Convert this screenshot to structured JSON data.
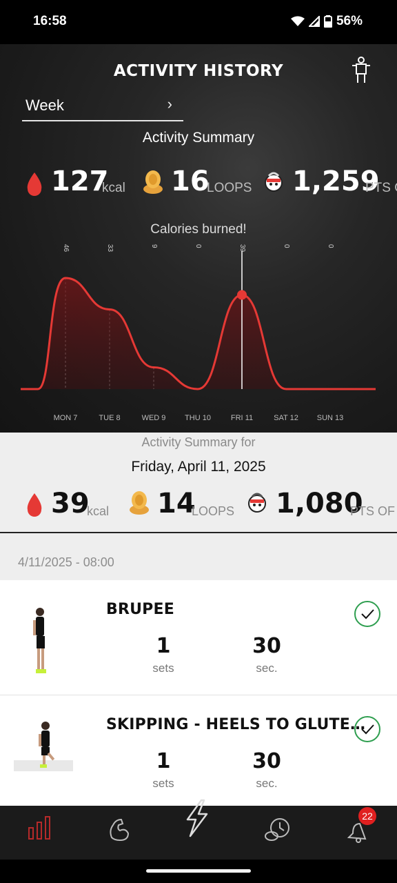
{
  "status_bar": {
    "time": "16:58",
    "battery": "56%"
  },
  "header": {
    "title": "ACTIVITY HISTORY",
    "icons": [
      "person-icon"
    ]
  },
  "period": {
    "label": "Week"
  },
  "summary": {
    "title": "Activity Summary",
    "kcal": "127",
    "kcal_unit": "kcal",
    "loops": "16",
    "loops_unit": "LOOPS",
    "pts": "1,259",
    "pts_unit": "PTS O"
  },
  "chart_data": {
    "type": "area",
    "title": "Calories burned!",
    "categories": [
      "MON 7",
      "TUE 8",
      "WED 9",
      "THU 10",
      "FRI 11",
      "SAT 12",
      "SUN 13"
    ],
    "values": [
      46,
      33,
      9,
      0,
      39,
      0,
      0
    ],
    "value_labels": [
      "46",
      "33",
      "9",
      "0",
      "39",
      "0",
      "0"
    ],
    "selected": "FRI 11",
    "colors": {
      "line": "#e53935",
      "fill": "#5a1416"
    }
  },
  "day_summary": {
    "title": "Activity Summary for",
    "date": "Friday, April 11, 2025",
    "kcal": "39",
    "kcal_unit": "kcal",
    "loops": "14",
    "loops_unit": "LOOPS",
    "pts": "1,080",
    "pts_unit": "PTS OF E"
  },
  "session": {
    "timestamp": "4/11/2025 - 08:00"
  },
  "exercises": [
    {
      "name": "BRUPEE",
      "sets": "1",
      "sets_label": "sets",
      "duration": "30",
      "duration_label": "sec."
    },
    {
      "name": "SKIPPING - HEELS TO GLUTE…",
      "sets": "1",
      "sets_label": "sets",
      "duration": "30",
      "duration_label": "sec."
    }
  ],
  "nav": {
    "items": [
      "stats-icon",
      "muscle-icon",
      "lightning-icon",
      "timer-icon",
      "bell-icon"
    ],
    "badge": "22"
  },
  "colors": {
    "accent": "#e53935",
    "check": "#2e9e4f"
  }
}
